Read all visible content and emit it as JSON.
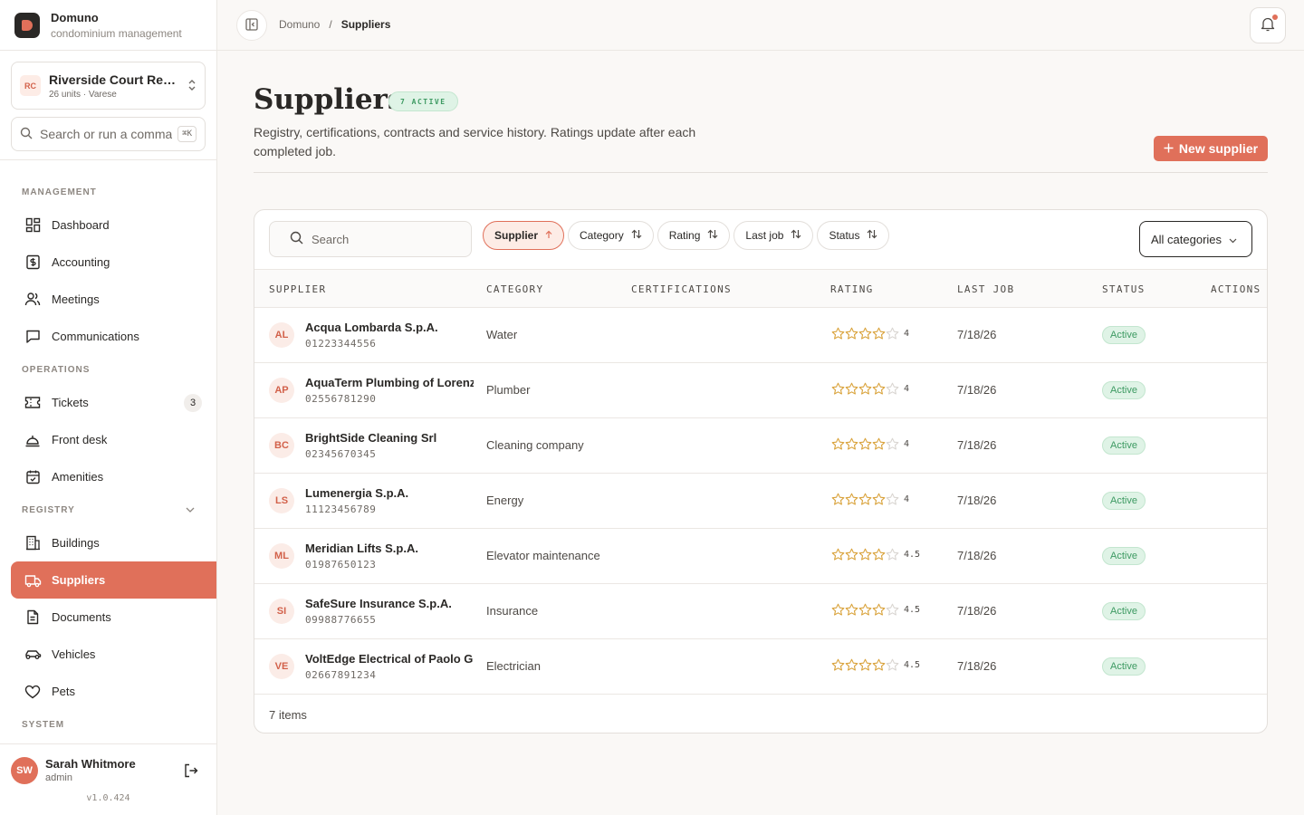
{
  "brand": {
    "name": "Domuno",
    "subtitle": "condominium management"
  },
  "tenant": {
    "initials": "RC",
    "name": "Riverside Court Residences",
    "meta": "26 units · Varese"
  },
  "command": {
    "placeholder": "Search or run a command",
    "shortcut": "⌘K"
  },
  "nav": {
    "management_label": "MANAGEMENT",
    "operations_label": "OPERATIONS",
    "registry_label": "REGISTRY",
    "system_label": "SYSTEM",
    "management": [
      {
        "label": "Dashboard",
        "icon": "dashboard-icon"
      },
      {
        "label": "Accounting",
        "icon": "accounting-icon"
      },
      {
        "label": "Meetings",
        "icon": "users-icon"
      },
      {
        "label": "Communications",
        "icon": "chat-icon"
      }
    ],
    "operations": [
      {
        "label": "Tickets",
        "icon": "ticket-icon",
        "count": "3"
      },
      {
        "label": "Front desk",
        "icon": "bell-icon"
      },
      {
        "label": "Amenities",
        "icon": "calendar-icon"
      }
    ],
    "registry": [
      {
        "label": "Buildings",
        "icon": "building-icon"
      },
      {
        "label": "Suppliers",
        "icon": "truck-icon",
        "active": true
      },
      {
        "label": "Documents",
        "icon": "document-icon"
      },
      {
        "label": "Vehicles",
        "icon": "car-icon"
      },
      {
        "label": "Pets",
        "icon": "heart-icon"
      }
    ]
  },
  "user": {
    "initials": "SW",
    "name": "Sarah Whitmore",
    "role": "admin",
    "version": "v1.0.424"
  },
  "breadcrumb": {
    "root": "Domuno",
    "separator": "/",
    "current": "Suppliers"
  },
  "page": {
    "title": "Suppliers",
    "badge": "7 ACTIVE",
    "description": "Registry, certifications, contracts and service history. Ratings update after each completed job.",
    "new_button": "New supplier"
  },
  "toolbar": {
    "search_placeholder": "Search",
    "sorts": [
      "Supplier",
      "Category",
      "Rating",
      "Last job",
      "Status"
    ],
    "category_filter": "All categories"
  },
  "table": {
    "columns": [
      "SUPPLIER",
      "CATEGORY",
      "CERTIFICATIONS",
      "RATING",
      "LAST JOB",
      "STATUS",
      "ACTIONS"
    ],
    "rows": [
      {
        "initials": "AL",
        "name": "Acqua Lombarda S.p.A.",
        "vat": "01223344556",
        "category": "Water",
        "rating": 4,
        "rating_label": "4",
        "last_job": "7/18/26",
        "status": "Active"
      },
      {
        "initials": "AP",
        "name": "AquaTerm Plumbing of Lorenzo",
        "vat": "02556781290",
        "category": "Plumber",
        "rating": 4,
        "rating_label": "4",
        "last_job": "7/18/26",
        "status": "Active"
      },
      {
        "initials": "BC",
        "name": "BrightSide Cleaning Srl",
        "vat": "02345670345",
        "category": "Cleaning company",
        "rating": 4,
        "rating_label": "4",
        "last_job": "7/18/26",
        "status": "Active"
      },
      {
        "initials": "LS",
        "name": "Lumenergia S.p.A.",
        "vat": "11123456789",
        "category": "Energy",
        "rating": 4,
        "rating_label": "4",
        "last_job": "7/18/26",
        "status": "Active"
      },
      {
        "initials": "ML",
        "name": "Meridian Lifts S.p.A.",
        "vat": "01987650123",
        "category": "Elevator maintenance",
        "rating": 4.5,
        "rating_label": "4.5",
        "last_job": "7/18/26",
        "status": "Active"
      },
      {
        "initials": "SI",
        "name": "SafeSure Insurance S.p.A.",
        "vat": "09988776655",
        "category": "Insurance",
        "rating": 4.5,
        "rating_label": "4.5",
        "last_job": "7/18/26",
        "status": "Active"
      },
      {
        "initials": "VE",
        "name": "VoltEdge Electrical of Paolo Grassi",
        "vat": "02667891234",
        "category": "Electrician",
        "rating": 4.5,
        "rating_label": "4.5",
        "last_job": "7/18/26",
        "status": "Active"
      }
    ],
    "footer": "7 items"
  },
  "colors": {
    "accent": "#e0705a",
    "success": "#3d9a62",
    "star": "#d9a23a"
  }
}
